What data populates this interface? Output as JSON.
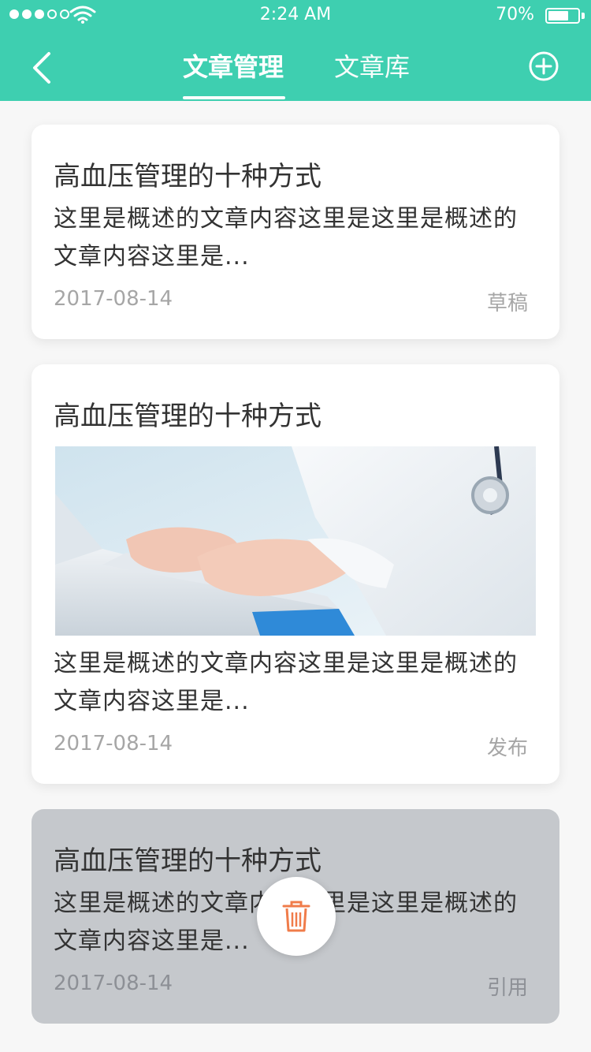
{
  "status_bar": {
    "time": "2:24 AM",
    "battery": "70%",
    "battery_level": 0.7,
    "signal_bars": 5,
    "signal_filled": 3,
    "wifi_icon": "wifi-icon"
  },
  "nav": {
    "back_icon": "chevron-left-icon",
    "tabs": [
      {
        "label": "文章管理",
        "active": true
      },
      {
        "label": "文章库",
        "active": false
      }
    ],
    "add_icon": "plus-circle-icon"
  },
  "articles": [
    {
      "title": "高血压管理的十种方式",
      "summary": "这里是概述的文章内容这里是这里是概述的文章内容这里是...",
      "date": "2017-08-14",
      "status": "草稿"
    },
    {
      "title": "高血压管理的十种方式",
      "image": "doctor-typing-on-laptop-photo",
      "summary": "这里是概述的文章内容这里是这里是概述的文章内容这里是...",
      "date": "2017-08-14",
      "status": "发布"
    },
    {
      "title": "高血压管理的十种方式",
      "summary": "这里是概述的文章内容这里是这里是概述的文章内容这里是...",
      "date": "2017-08-14",
      "status": "引用",
      "selected": true
    }
  ],
  "delete_action": {
    "icon": "trash-icon"
  },
  "colors": {
    "brand": "#3ecfb0",
    "delete": "#f07c4a",
    "selected_card": "#c5c8cc"
  }
}
